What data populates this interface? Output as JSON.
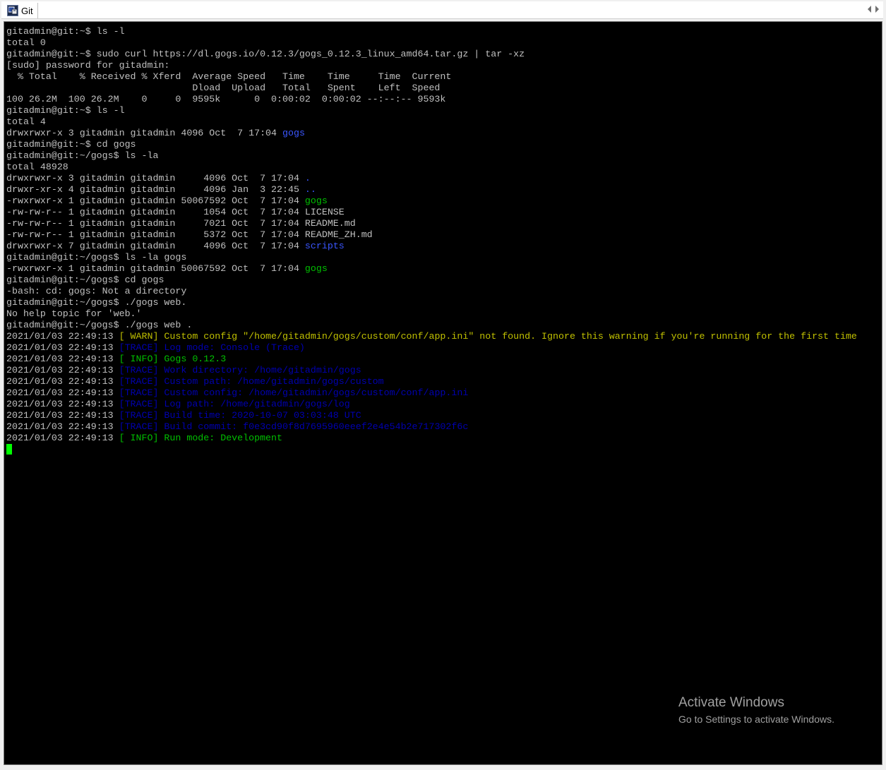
{
  "tab": {
    "label": "Git",
    "icon": "putty-terminal-icon"
  },
  "terminal": {
    "colors": {
      "default": "#c0c0c0",
      "blue": "#3a56ff",
      "dark_blue": "#0000b0",
      "green": "#00c000",
      "yellow": "#c0c000",
      "cursor": "#00ff00"
    },
    "lines": [
      {
        "segments": [
          {
            "text": "gitadmin@git:~$ ls -l",
            "color": "default"
          }
        ]
      },
      {
        "segments": [
          {
            "text": "total 0",
            "color": "default"
          }
        ]
      },
      {
        "segments": [
          {
            "text": "gitadmin@git:~$ sudo curl https://dl.gogs.io/0.12.3/gogs_0.12.3_linux_amd64.tar.gz | tar -xz",
            "color": "default"
          }
        ]
      },
      {
        "segments": [
          {
            "text": "[sudo] password for gitadmin:",
            "color": "default"
          }
        ]
      },
      {
        "segments": [
          {
            "text": "  % Total    % Received % Xferd  Average Speed   Time    Time     Time  Current",
            "color": "default"
          }
        ]
      },
      {
        "segments": [
          {
            "text": "                                 Dload  Upload   Total   Spent    Left  Speed",
            "color": "default"
          }
        ]
      },
      {
        "segments": [
          {
            "text": "100 26.2M  100 26.2M    0     0  9595k      0  0:00:02  0:00:02 --:--:-- 9593k",
            "color": "default"
          }
        ]
      },
      {
        "segments": [
          {
            "text": "gitadmin@git:~$ ls -l",
            "color": "default"
          }
        ]
      },
      {
        "segments": [
          {
            "text": "total 4",
            "color": "default"
          }
        ]
      },
      {
        "segments": [
          {
            "text": "drwxrwxr-x 3 gitadmin gitadmin 4096 Oct  7 17:04 ",
            "color": "default"
          },
          {
            "text": "gogs",
            "color": "blue"
          }
        ]
      },
      {
        "segments": [
          {
            "text": "gitadmin@git:~$ cd gogs",
            "color": "default"
          }
        ]
      },
      {
        "segments": [
          {
            "text": "gitadmin@git:~/gogs$ ls -la",
            "color": "default"
          }
        ]
      },
      {
        "segments": [
          {
            "text": "total 48928",
            "color": "default"
          }
        ]
      },
      {
        "segments": [
          {
            "text": "drwxrwxr-x 3 gitadmin gitadmin     4096 Oct  7 17:04 ",
            "color": "default"
          },
          {
            "text": ".",
            "color": "blue"
          }
        ]
      },
      {
        "segments": [
          {
            "text": "drwxr-xr-x 4 gitadmin gitadmin     4096 Jan  3 22:45 ",
            "color": "default"
          },
          {
            "text": "..",
            "color": "blue"
          }
        ]
      },
      {
        "segments": [
          {
            "text": "-rwxrwxr-x 1 gitadmin gitadmin 50067592 Oct  7 17:04 ",
            "color": "default"
          },
          {
            "text": "gogs",
            "color": "green"
          }
        ]
      },
      {
        "segments": [
          {
            "text": "-rw-rw-r-- 1 gitadmin gitadmin     1054 Oct  7 17:04 LICENSE",
            "color": "default"
          }
        ]
      },
      {
        "segments": [
          {
            "text": "-rw-rw-r-- 1 gitadmin gitadmin     7021 Oct  7 17:04 README.md",
            "color": "default"
          }
        ]
      },
      {
        "segments": [
          {
            "text": "-rw-rw-r-- 1 gitadmin gitadmin     5372 Oct  7 17:04 README_ZH.md",
            "color": "default"
          }
        ]
      },
      {
        "segments": [
          {
            "text": "drwxrwxr-x 7 gitadmin gitadmin     4096 Oct  7 17:04 ",
            "color": "default"
          },
          {
            "text": "scripts",
            "color": "blue"
          }
        ]
      },
      {
        "segments": [
          {
            "text": "gitadmin@git:~/gogs$ ls -la gogs",
            "color": "default"
          }
        ]
      },
      {
        "segments": [
          {
            "text": "-rwxrwxr-x 1 gitadmin gitadmin 50067592 Oct  7 17:04 ",
            "color": "default"
          },
          {
            "text": "gogs",
            "color": "green"
          }
        ]
      },
      {
        "segments": [
          {
            "text": "gitadmin@git:~/gogs$ cd gogs",
            "color": "default"
          }
        ]
      },
      {
        "segments": [
          {
            "text": "-bash: cd: gogs: Not a directory",
            "color": "default"
          }
        ]
      },
      {
        "segments": [
          {
            "text": "gitadmin@git:~/gogs$ ./gogs web.",
            "color": "default"
          }
        ]
      },
      {
        "segments": [
          {
            "text": "No help topic for 'web.'",
            "color": "default"
          }
        ]
      },
      {
        "segments": [
          {
            "text": "gitadmin@git:~/gogs$ ./gogs web .",
            "color": "default"
          }
        ]
      },
      {
        "segments": [
          {
            "text": "2021/01/03 22:49:13 ",
            "color": "default"
          },
          {
            "text": "[ WARN] Custom config \"/home/gitadmin/gogs/custom/conf/app.ini\" not found. Ignore this warning if you're running for the first time",
            "color": "yellow"
          }
        ]
      },
      {
        "segments": [
          {
            "text": "2021/01/03 22:49:13 ",
            "color": "default"
          },
          {
            "text": "[TRACE] Log mode: Console (Trace)",
            "color": "dark_blue"
          }
        ]
      },
      {
        "segments": [
          {
            "text": "2021/01/03 22:49:13 ",
            "color": "default"
          },
          {
            "text": "[ INFO] Gogs 0.12.3",
            "color": "green"
          }
        ]
      },
      {
        "segments": [
          {
            "text": "2021/01/03 22:49:13 ",
            "color": "default"
          },
          {
            "text": "[TRACE] Work directory: /home/gitadmin/gogs",
            "color": "dark_blue"
          }
        ]
      },
      {
        "segments": [
          {
            "text": "2021/01/03 22:49:13 ",
            "color": "default"
          },
          {
            "text": "[TRACE] Custom path: /home/gitadmin/gogs/custom",
            "color": "dark_blue"
          }
        ]
      },
      {
        "segments": [
          {
            "text": "2021/01/03 22:49:13 ",
            "color": "default"
          },
          {
            "text": "[TRACE] Custom config: /home/gitadmin/gogs/custom/conf/app.ini",
            "color": "dark_blue"
          }
        ]
      },
      {
        "segments": [
          {
            "text": "2021/01/03 22:49:13 ",
            "color": "default"
          },
          {
            "text": "[TRACE] Log path: /home/gitadmin/gogs/log",
            "color": "dark_blue"
          }
        ]
      },
      {
        "segments": [
          {
            "text": "2021/01/03 22:49:13 ",
            "color": "default"
          },
          {
            "text": "[TRACE] Build time: 2020-10-07 03:03:48 UTC",
            "color": "dark_blue"
          }
        ]
      },
      {
        "segments": [
          {
            "text": "2021/01/03 22:49:13 ",
            "color": "default"
          },
          {
            "text": "[TRACE] Build commit: f0e3cd90f8d7695960eeef2e4e54b2e717302f6c",
            "color": "dark_blue"
          }
        ]
      },
      {
        "segments": [
          {
            "text": "2021/01/03 22:49:13 ",
            "color": "default"
          },
          {
            "text": "[ INFO] Run mode: Development",
            "color": "green"
          }
        ]
      }
    ]
  },
  "watermark": {
    "title": "Activate Windows",
    "subtitle": "Go to Settings to activate Windows."
  }
}
